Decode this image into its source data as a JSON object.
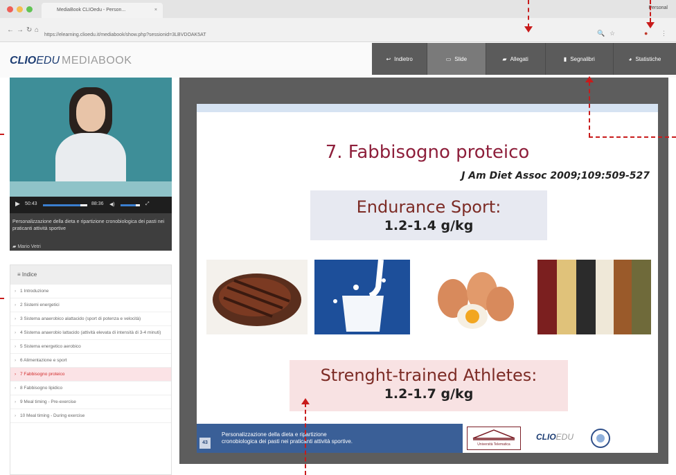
{
  "browser": {
    "tab_title": "MediaBook CLIOedu - Person...",
    "tab_close": "×",
    "user_name": "Personal",
    "url": "https://elearning.clioedu.it/mediabook/show.php?sessionid=3LBVDOAK5AT",
    "back_icon": "back-arrow-icon",
    "forward_icon": "forward-arrow-icon",
    "reload_icon": "reload-icon",
    "home_icon": "home-icon",
    "info_icon": "info-icon"
  },
  "app": {
    "logo_clio": "CLIO",
    "logo_edu": "EDU",
    "logo_product": "MEDIABOOK"
  },
  "toolbar": {
    "items": [
      {
        "label": "Indietro",
        "icon": "back-icon"
      },
      {
        "label": "Slide",
        "icon": "monitor-icon"
      },
      {
        "label": "Allegati",
        "icon": "folder-icon"
      },
      {
        "label": "Segnalibri",
        "icon": "bookmark-icon"
      },
      {
        "label": "Statistiche",
        "icon": "pie-chart-icon"
      }
    ]
  },
  "video": {
    "current_time": "50:43",
    "duration": "88:36",
    "title": "Personalizzazione della dieta e ripartizione cronobiologica dei pasti nei praticanti attività sportive",
    "author": "Mario Vetri"
  },
  "index": {
    "heading": "Indice",
    "items": [
      "1 Introduzione",
      "2 Sistemi energetici",
      "3 Sistema anaerobico alattacido (sport di potenza e velocità)",
      "4 Sistema anaerobio lattacido (attività elevata di intensità di 3-4 minuti)",
      "5 Sistema energetico aerobico",
      "6 Alimentazione e sport",
      "7 Fabbisogno proteico",
      "8 Fabbisogno lipidico",
      "9 Meal timing - Pre-exercise",
      "10 Meal timing - During exercise"
    ]
  },
  "slide": {
    "number": "43",
    "title": "7. Fabbisogno proteico",
    "reference": "J Am Diet Assoc 2009;109:509-527",
    "box1_heading": "Endurance Sport:",
    "box1_value": "1.2-1.4 g/kg",
    "box2_heading": "Strenght-trained Athletes:",
    "box2_value": "1.2-1.7 g/kg",
    "footer_line1": "Personalizzazione della dieta e ripartizione",
    "footer_line2": "cronobiologica dei pasti nei praticanti attività sportive.",
    "footer_university": "Università Telematica",
    "footer_logo_clio": "CLIO",
    "footer_logo_edu": "EDU"
  },
  "colors": {
    "toolbar_bg": "#5b5b5b",
    "accent_red": "#c81b1b",
    "slide_title": "#8e1f3b",
    "footer_blue": "#3a5f97"
  }
}
